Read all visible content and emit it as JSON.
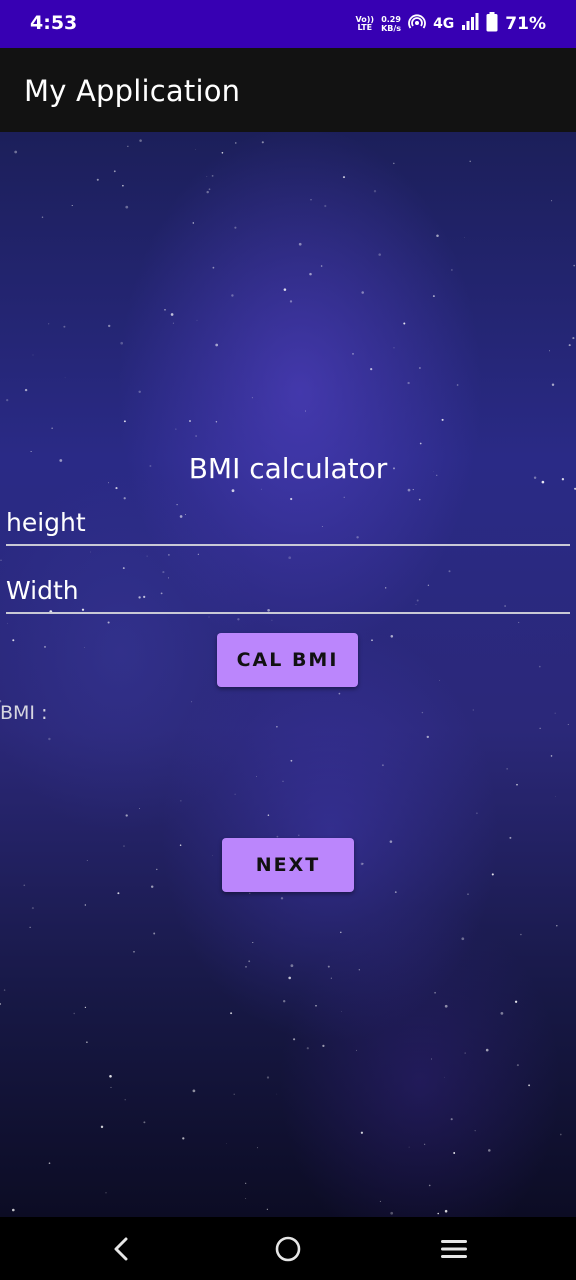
{
  "status_bar": {
    "time": "4:53",
    "volte_top": "Vo))",
    "volte_bottom": "LTE",
    "speed_value": "0.29",
    "speed_unit": "KB/s",
    "network": "4G",
    "battery": "71%",
    "bg_color": "#3700b3"
  },
  "app_bar": {
    "title": "My Application",
    "bg_color": "#121212"
  },
  "form": {
    "heading": "BMI calculator",
    "height_placeholder": "height",
    "width_placeholder": "Width",
    "cal_button": "CAL BMI",
    "bmi_label": "BMI :",
    "next_button": "NEXT",
    "button_color": "#bb86fc"
  },
  "nav_bar": {
    "icons": [
      "back-icon",
      "home-icon",
      "recents-icon"
    ]
  }
}
